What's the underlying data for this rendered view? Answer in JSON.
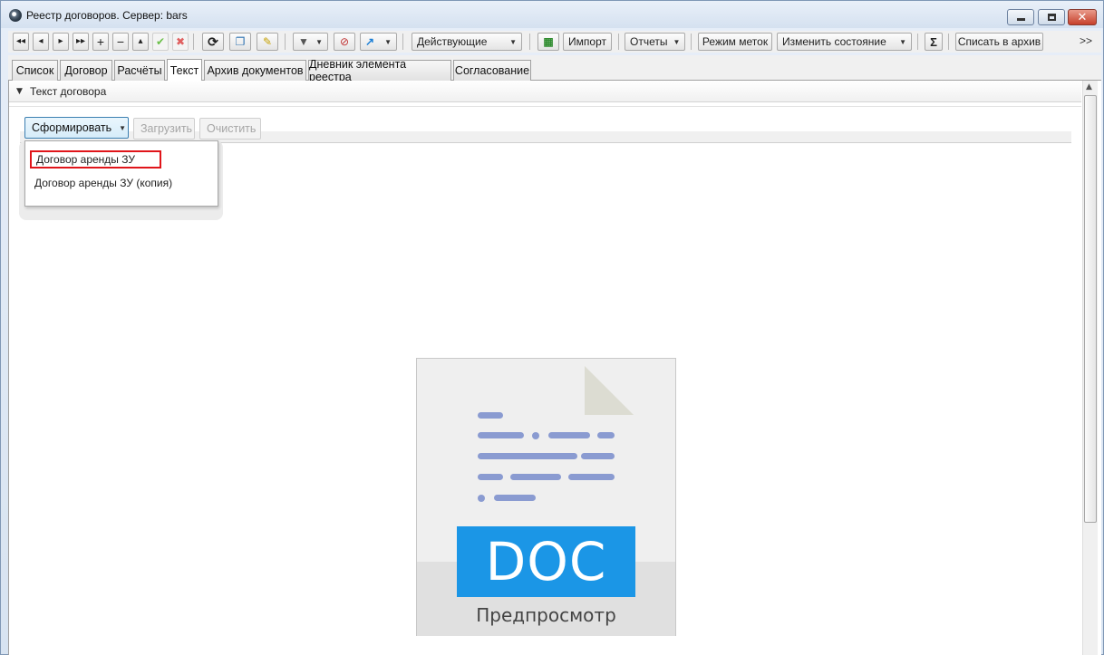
{
  "window": {
    "title": "Реестр договоров. Сервер: bars"
  },
  "toolbar": {
    "filter_state": "Действующие",
    "import": "Импорт",
    "reports": "Отчеты",
    "label_mode": "Режим меток",
    "change_state": "Изменить состояние",
    "sum_symbol": "Σ",
    "archive": "Списать в архив",
    "overflow": ">>"
  },
  "tabs": [
    {
      "label": "Список"
    },
    {
      "label": "Договор"
    },
    {
      "label": "Расчёты"
    },
    {
      "label": "Текст",
      "active": true
    },
    {
      "label": "Архив документов"
    },
    {
      "label": "Дневник элемента реестра"
    },
    {
      "label": "Согласование"
    }
  ],
  "section": {
    "title": "Текст договора"
  },
  "actions": {
    "generate": "Сформировать",
    "load": "Загрузить",
    "clear": "Очистить"
  },
  "dropdown": {
    "items": [
      {
        "label": "Договор аренды ЗУ",
        "highlighted": true
      },
      {
        "label": "Договор аренды ЗУ (копия)"
      }
    ]
  },
  "preview": {
    "format": "DOC",
    "label": "Предпросмотр"
  },
  "colors": {
    "highlight_border": "#e0151a",
    "doc_badge": "#1b96e6",
    "doc_lines": "#8a9bd1"
  }
}
